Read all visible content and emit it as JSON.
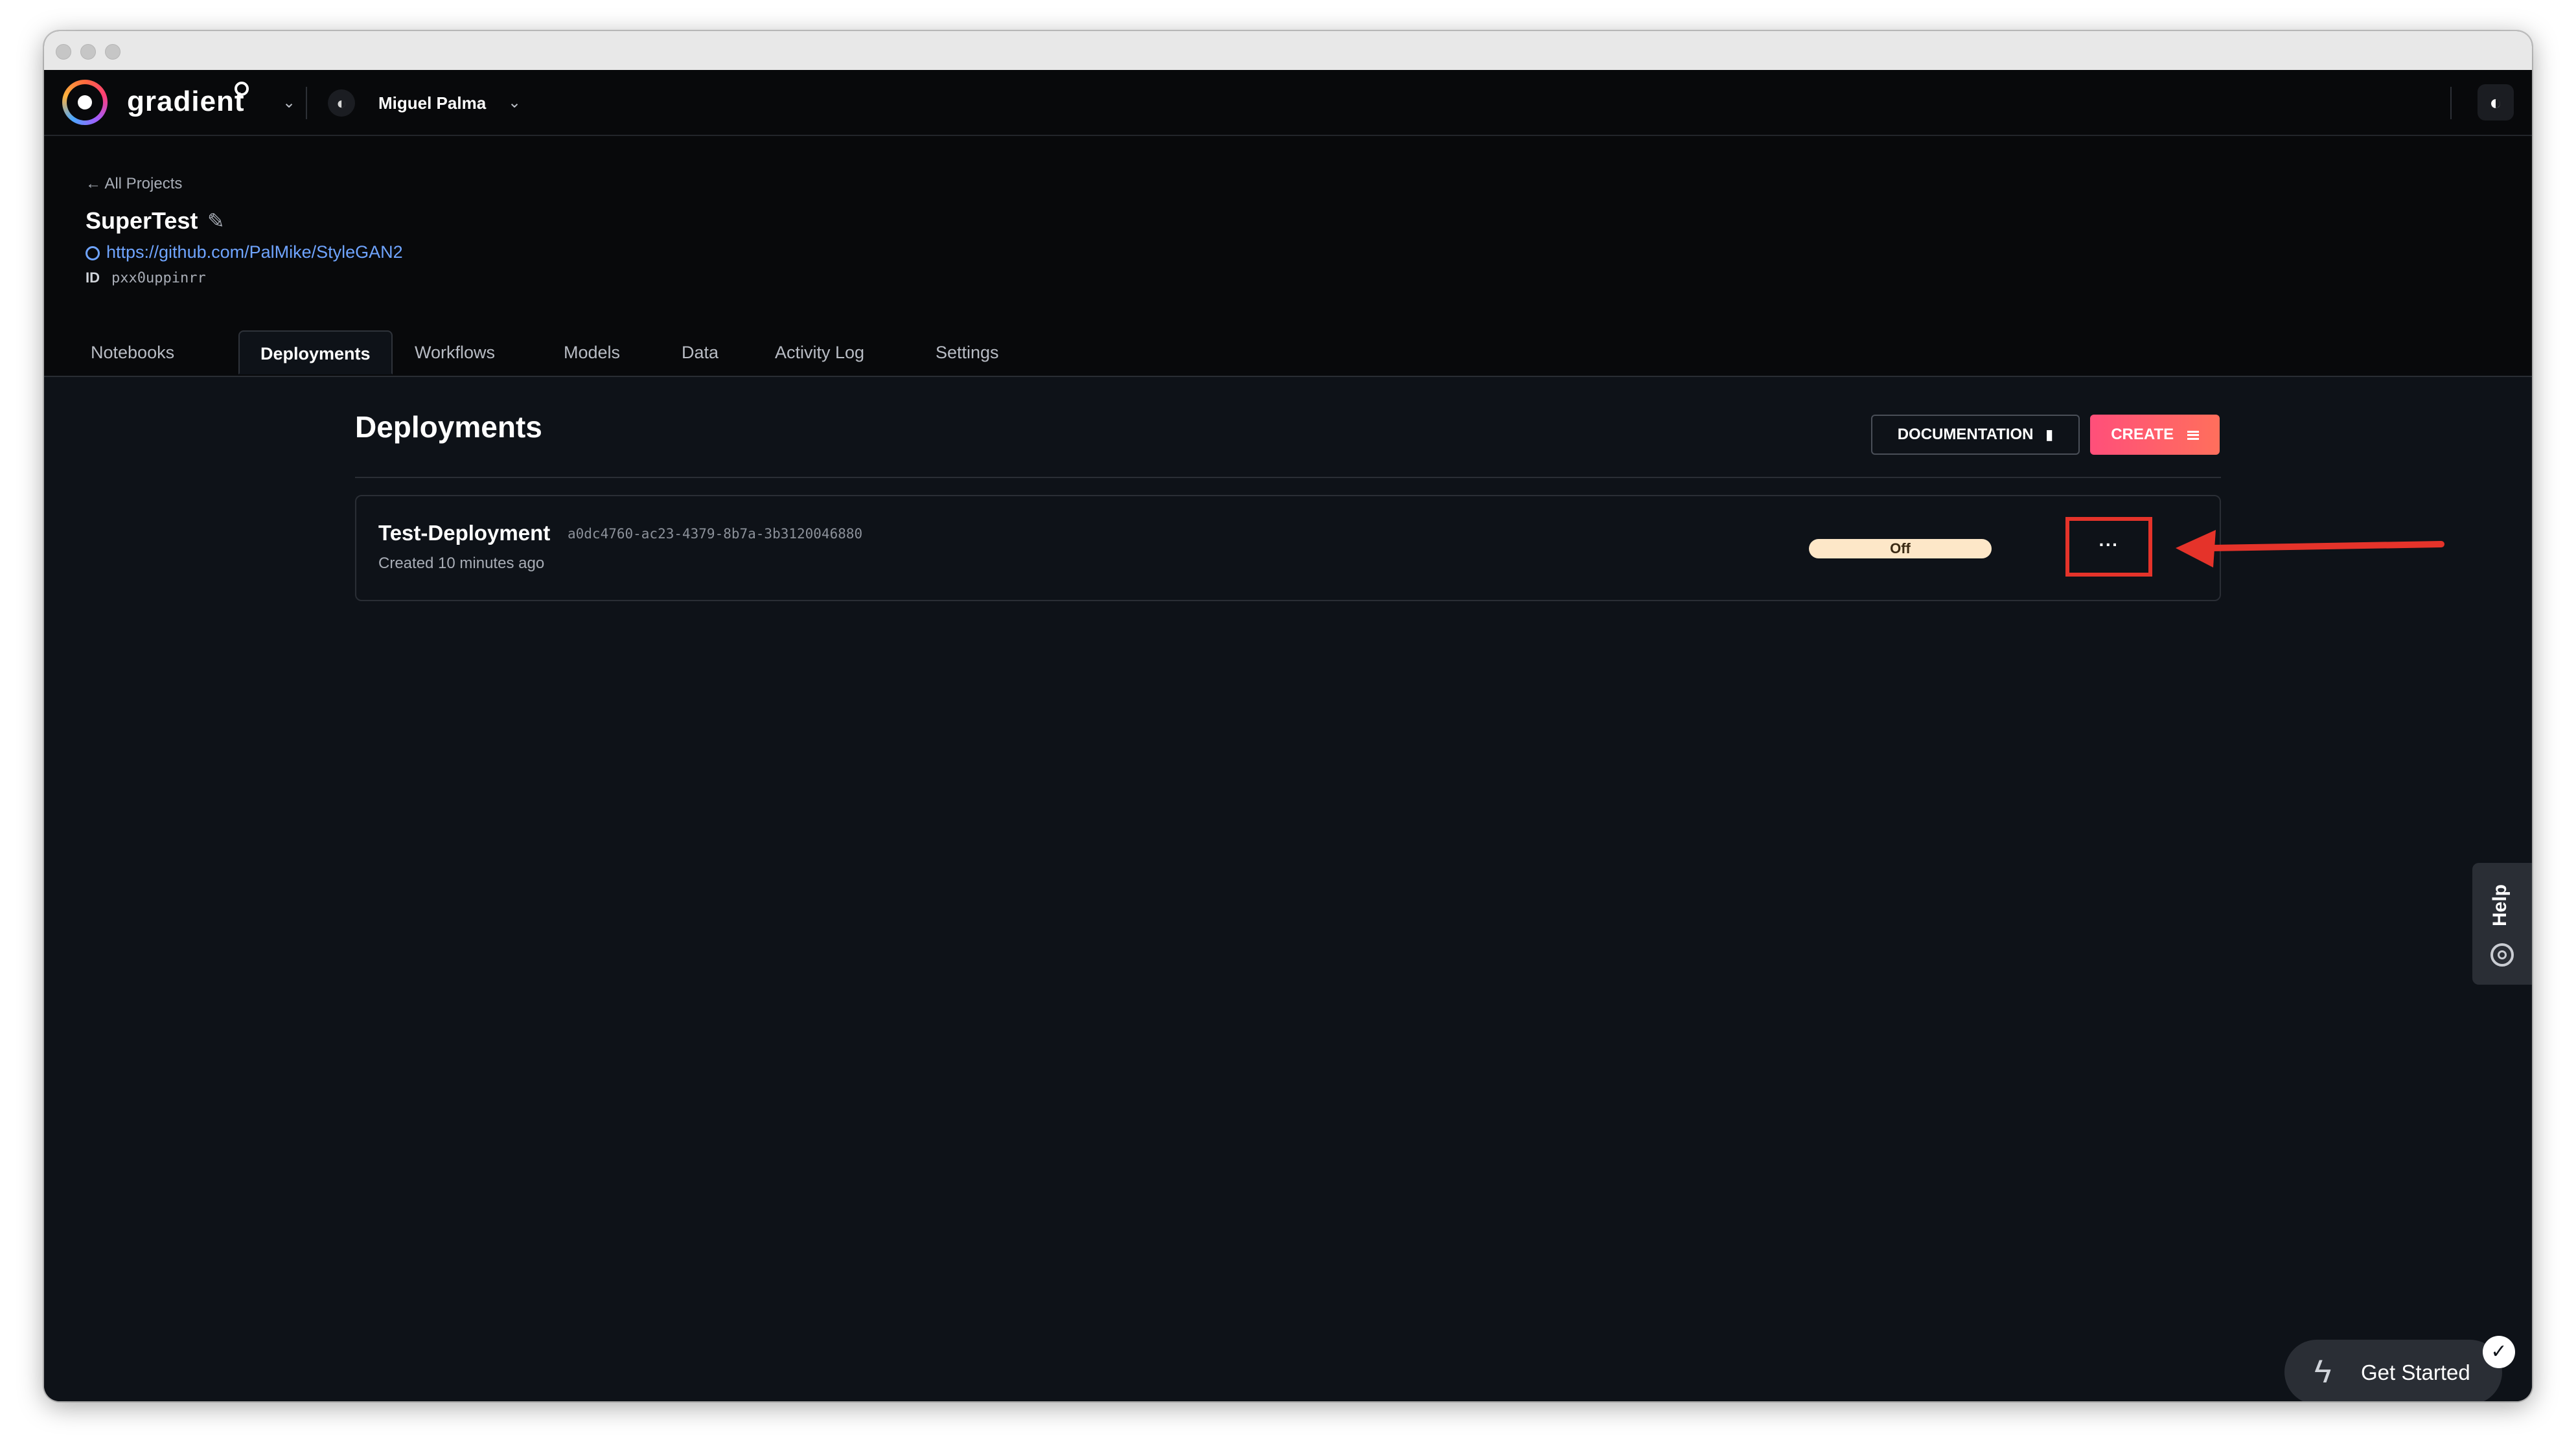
{
  "brand": {
    "name": "gradient"
  },
  "topnav": {
    "user_name": "Miguel Palma"
  },
  "project": {
    "back_label": "← All Projects",
    "title": "SuperTest",
    "repo_url": "https://github.com/PalMike/StyleGAN2",
    "id_label": "ID",
    "id_value": "pxx0uppinrr"
  },
  "tabs": [
    {
      "label": "Notebooks",
      "active": false
    },
    {
      "label": "Deployments",
      "active": true
    },
    {
      "label": "Workflows",
      "active": false
    },
    {
      "label": "Models",
      "active": false
    },
    {
      "label": "Data",
      "active": false
    },
    {
      "label": "Activity Log",
      "active": false
    },
    {
      "label": "Settings",
      "active": false
    }
  ],
  "main": {
    "title": "Deployments",
    "documentation_label": "DOCUMENTATION",
    "create_label": "CREATE"
  },
  "deployments": [
    {
      "name": "Test-Deployment",
      "id": "a0dc4760-ac23-4379-8b7a-3b3120046880",
      "created": "Created 10 minutes ago",
      "status": "Off",
      "more_label": "···"
    }
  ],
  "help": {
    "label": "Help"
  },
  "get_started": {
    "label": "Get Started"
  },
  "colors": {
    "background": "#0e1218",
    "nav": "#08090b",
    "accent_create": "#ff5a6e",
    "link": "#6fa4ff",
    "status_off": "#fde7c8",
    "annotation_red": "#e5332a"
  }
}
